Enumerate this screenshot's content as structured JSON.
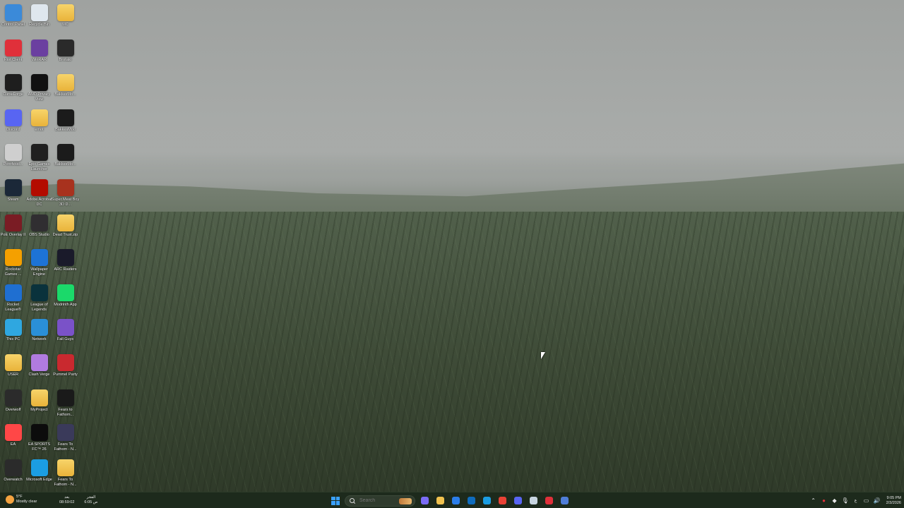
{
  "desktop_icons": [
    {
      "label": "Control Panel",
      "icon": "control-panel-icon",
      "color": "#3b8ad9"
    },
    {
      "label": "Recycle Bin",
      "icon": "recycle-bin-icon",
      "color": "#dfe7ee"
    },
    {
      "label": "MC",
      "icon": "folder-icon",
      "color": "#f1c24f"
    },
    {
      "label": "Riot Client",
      "icon": "riot-client-icon",
      "color": "#e0303a"
    },
    {
      "label": "WinRAR",
      "icon": "winrar-icon",
      "color": "#6b3fa0"
    },
    {
      "label": "Brotato",
      "icon": "brotato-icon",
      "color": "#2a2a2a"
    },
    {
      "label": "CurseForge",
      "icon": "curseforge-icon",
      "color": "#1e1e1e"
    },
    {
      "label": "AMD Privacy View",
      "icon": "amd-privacy-view-icon",
      "color": "#111111"
    },
    {
      "label": "BakkesMo...",
      "icon": "folder-icon",
      "color": "#f1c24f"
    },
    {
      "label": "Discord",
      "icon": "discord-icon",
      "color": "#5865f2"
    },
    {
      "label": "emot",
      "icon": "folder-icon",
      "color": "#f1c24f"
    },
    {
      "label": "BakkesMod",
      "icon": "bakkesmod-icon",
      "color": "#1b1b1b"
    },
    {
      "label": "Porofessi...",
      "icon": "porofessor-icon",
      "color": "#cfcfcf"
    },
    {
      "label": "Epic Games Launcher",
      "icon": "epic-games-icon",
      "color": "#202020"
    },
    {
      "label": "BakkesMo...",
      "icon": "bakkesmod-icon",
      "color": "#1b1b1b"
    },
    {
      "label": "Steam",
      "icon": "steam-icon",
      "color": "#1b2838"
    },
    {
      "label": "Adobe Acrobat DC",
      "icon": "adobe-acrobat-icon",
      "color": "#b30b00"
    },
    {
      "label": "Super Meat Boy 3D D...",
      "icon": "super-meat-boy-icon",
      "color": "#a8321e"
    },
    {
      "label": "PoE Overlay II",
      "icon": "poe-overlay-icon",
      "color": "#7a1c24"
    },
    {
      "label": "OBS Studio",
      "icon": "obs-studio-icon",
      "color": "#302e31"
    },
    {
      "label": "Dead Trust.zip",
      "icon": "zip-folder-icon",
      "color": "#f1c24f"
    },
    {
      "label": "Rockstar Games ...",
      "icon": "rockstar-games-icon",
      "color": "#f4a000"
    },
    {
      "label": "Wallpaper Engine",
      "icon": "wallpaper-engine-icon",
      "color": "#1d73d6"
    },
    {
      "label": "ARC Raiders",
      "icon": "arc-raiders-icon",
      "color": "#1a1a2a"
    },
    {
      "label": "Rocket League®",
      "icon": "rocket-league-icon",
      "color": "#1f6fd1"
    },
    {
      "label": "League of Legends",
      "icon": "league-of-legends-icon",
      "color": "#0a323c"
    },
    {
      "label": "Modrinth App",
      "icon": "modrinth-icon",
      "color": "#1bd96a"
    },
    {
      "label": "This PC",
      "icon": "this-pc-icon",
      "color": "#2fa7e0"
    },
    {
      "label": "Network",
      "icon": "network-icon",
      "color": "#2a8fd8"
    },
    {
      "label": "Fall Guys",
      "icon": "fall-guys-icon",
      "color": "#7a52c8"
    },
    {
      "label": "USER",
      "icon": "folder-icon",
      "color": "#f1c24f"
    },
    {
      "label": "Clash Verge",
      "icon": "clash-verge-icon",
      "color": "#b07be0"
    },
    {
      "label": "Pummel Party",
      "icon": "pummel-party-icon",
      "color": "#c9292f"
    },
    {
      "label": "Overwolf",
      "icon": "overwolf-icon",
      "color": "#2b2b2b"
    },
    {
      "label": "MyProject",
      "icon": "folder-icon",
      "color": "#f1c24f"
    },
    {
      "label": "Fears to Fathom...",
      "icon": "fears-to-fathom-icon",
      "color": "#1a1a1a"
    },
    {
      "label": "EA",
      "icon": "ea-icon",
      "color": "#ff4747"
    },
    {
      "label": "EA SPORTS FC™ 26",
      "icon": "ea-sports-fc-icon",
      "color": "#0c0c0c"
    },
    {
      "label": "Fears To Fathom - N...",
      "icon": "fears-to-fathom-icon",
      "color": "#3a3a5a"
    },
    {
      "label": "Overwatch",
      "icon": "overwatch-icon",
      "color": "#2b2b2b"
    },
    {
      "label": "Microsoft Edge",
      "icon": "edge-icon",
      "color": "#1b9de2"
    },
    {
      "label": "Fears To Fathom - N...",
      "icon": "folder-icon",
      "color": "#f1c24f"
    }
  ],
  "taskbar": {
    "weather": {
      "temp": "5°F",
      "condition": "Mostly clear"
    },
    "prayer": [
      {
        "name": "الفجر",
        "time": "08:59:02"
      },
      {
        "name": "بعد",
        "time": "6:05 ص"
      }
    ],
    "search": {
      "placeholder": "Search"
    },
    "pinned_apps": [
      {
        "name": "copilot-icon",
        "color": "#7b6cf6"
      },
      {
        "name": "file-explorer-icon",
        "color": "#f1c24f"
      },
      {
        "name": "microsoft-store-icon",
        "color": "#2b7de9"
      },
      {
        "name": "outlook-icon",
        "color": "#0f6cbd"
      },
      {
        "name": "edge-icon",
        "color": "#1b9de2"
      },
      {
        "name": "chrome-icon",
        "color": "#e94235"
      },
      {
        "name": "discord-icon",
        "color": "#5865f2"
      },
      {
        "name": "steam-icon",
        "color": "#c7d5e0"
      },
      {
        "name": "riot-client-icon",
        "color": "#e0303a"
      },
      {
        "name": "app-icon",
        "color": "#4f7dd8"
      }
    ],
    "tray": {
      "clock_time": "9:05 PM",
      "clock_date": "2/3/2026"
    }
  }
}
